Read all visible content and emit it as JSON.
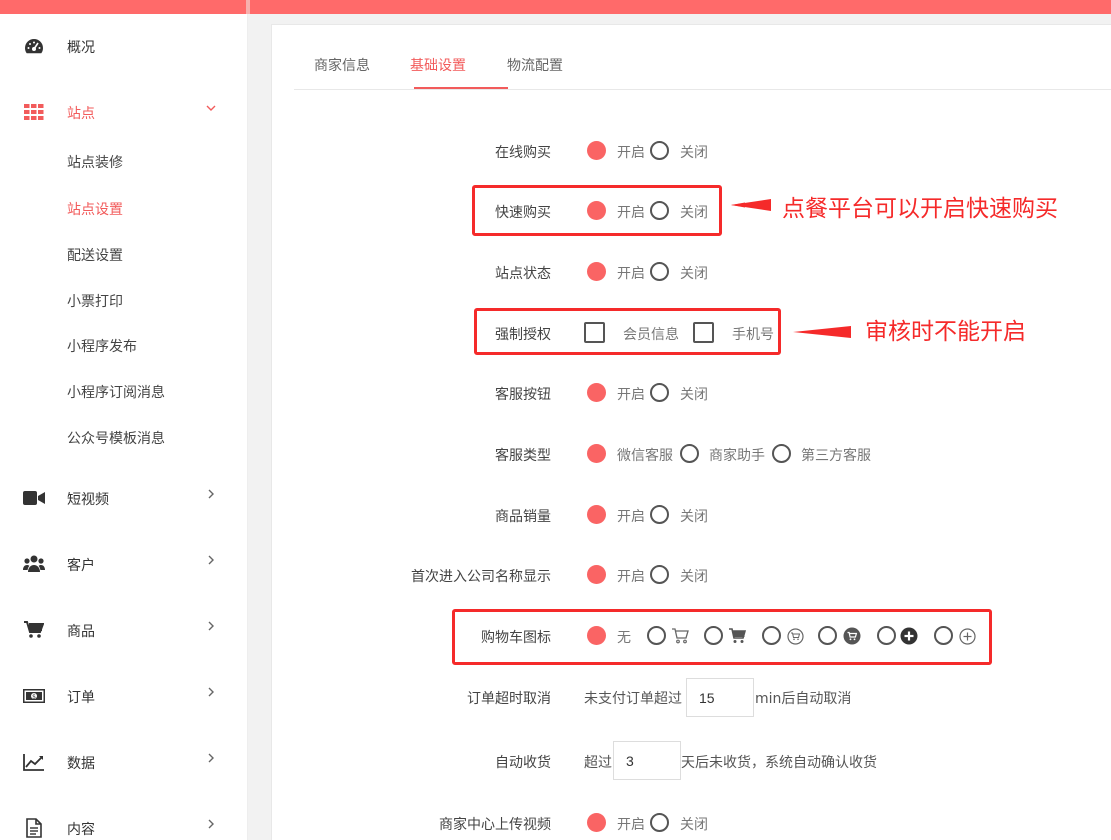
{
  "sidebar": {
    "items": [
      {
        "label": "概况",
        "icon": "dashboard-icon"
      },
      {
        "label": "站点",
        "icon": "grid-icon",
        "expanded": true
      },
      {
        "label": "短视频",
        "icon": "video-icon"
      },
      {
        "label": "客户",
        "icon": "users-icon"
      },
      {
        "label": "商品",
        "icon": "cart-icon"
      },
      {
        "label": "订单",
        "icon": "money-icon"
      },
      {
        "label": "数据",
        "icon": "chart-icon"
      },
      {
        "label": "内容",
        "icon": "document-icon"
      }
    ],
    "sub_items": [
      "站点装修",
      "站点设置",
      "配送设置",
      "小票打印",
      "小程序发布",
      "小程序订阅消息",
      "公众号模板消息"
    ],
    "active_sub": "站点设置"
  },
  "tabs": [
    "商家信息",
    "基础设置",
    "物流配置"
  ],
  "active_tab": "基础设置",
  "settings": {
    "online_buy": {
      "label": "在线购买",
      "on": "开启",
      "off": "关闭"
    },
    "quick_buy": {
      "label": "快速购买",
      "on": "开启",
      "off": "关闭"
    },
    "site_status": {
      "label": "站点状态",
      "on": "开启",
      "off": "关闭"
    },
    "force_auth": {
      "label": "强制授权",
      "opt1": "会员信息",
      "opt2": "手机号"
    },
    "service_button": {
      "label": "客服按钮",
      "on": "开启",
      "off": "关闭"
    },
    "service_type": {
      "label": "客服类型",
      "opt1": "微信客服",
      "opt2": "商家助手",
      "opt3": "第三方客服"
    },
    "sales_volume": {
      "label": "商品销量",
      "on": "开启",
      "off": "关闭"
    },
    "company_name": {
      "label": "首次进入公司名称显示",
      "on": "开启",
      "off": "关闭"
    },
    "cart_icon": {
      "label": "购物车图标",
      "none": "无"
    },
    "order_timeout": {
      "label": "订单超时取消",
      "prefix": "未支付订单超过",
      "value": "15",
      "suffix": "min后自动取消"
    },
    "auto_receive": {
      "label": "自动收货",
      "prefix": "超过",
      "value": "3",
      "suffix": "天后未收货，系统自动确认收货"
    },
    "upload_video": {
      "label": "商家中心上传视频",
      "on": "开启",
      "off": "关闭"
    }
  },
  "annotations": {
    "quick_buy_note": "点餐平台可以开启快速购买",
    "force_auth_note": "审核时不能开启"
  },
  "colors": {
    "accent": "#f25b5b",
    "radio_on": "#fa6464",
    "annotation": "#f52a2a",
    "topbar": "#ff6a6a"
  }
}
